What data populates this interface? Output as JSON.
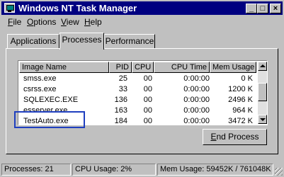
{
  "window": {
    "title": "Windows NT Task Manager",
    "min_glyph": "_",
    "max_glyph": "□",
    "close_glyph": "×"
  },
  "menu": {
    "items": [
      {
        "mnemonic": "F",
        "rest": "ile"
      },
      {
        "mnemonic": "O",
        "rest": "ptions"
      },
      {
        "mnemonic": "V",
        "rest": "iew"
      },
      {
        "mnemonic": "H",
        "rest": "elp"
      }
    ]
  },
  "tabs": [
    "Applications",
    "Processes",
    "Performance"
  ],
  "active_tab": "Processes",
  "processes": {
    "columns": [
      "Image Name",
      "PID",
      "CPU",
      "CPU Time",
      "Mem Usage"
    ],
    "rows": [
      [
        "smss.exe",
        "25",
        "00",
        "0:00:00",
        "0 K"
      ],
      [
        "csrss.exe",
        "33",
        "00",
        "0:00:00",
        "1200 K"
      ],
      [
        "SQLEXEC.EXE",
        "136",
        "00",
        "0:00:00",
        "2496 K"
      ],
      [
        "esserver.exe",
        "163",
        "00",
        "0:00:00",
        "964 K"
      ],
      [
        "TestAuto.exe",
        "184",
        "00",
        "0:00:00",
        "3472 K"
      ]
    ],
    "highlighted_row": "TestAuto.exe"
  },
  "end_process": {
    "mnemonic": "E",
    "rest": "nd Process"
  },
  "status": {
    "processes": "Processes: 21",
    "cpu": "CPU Usage: 2%",
    "mem": "Mem Usage: 59452K / 761048K"
  }
}
